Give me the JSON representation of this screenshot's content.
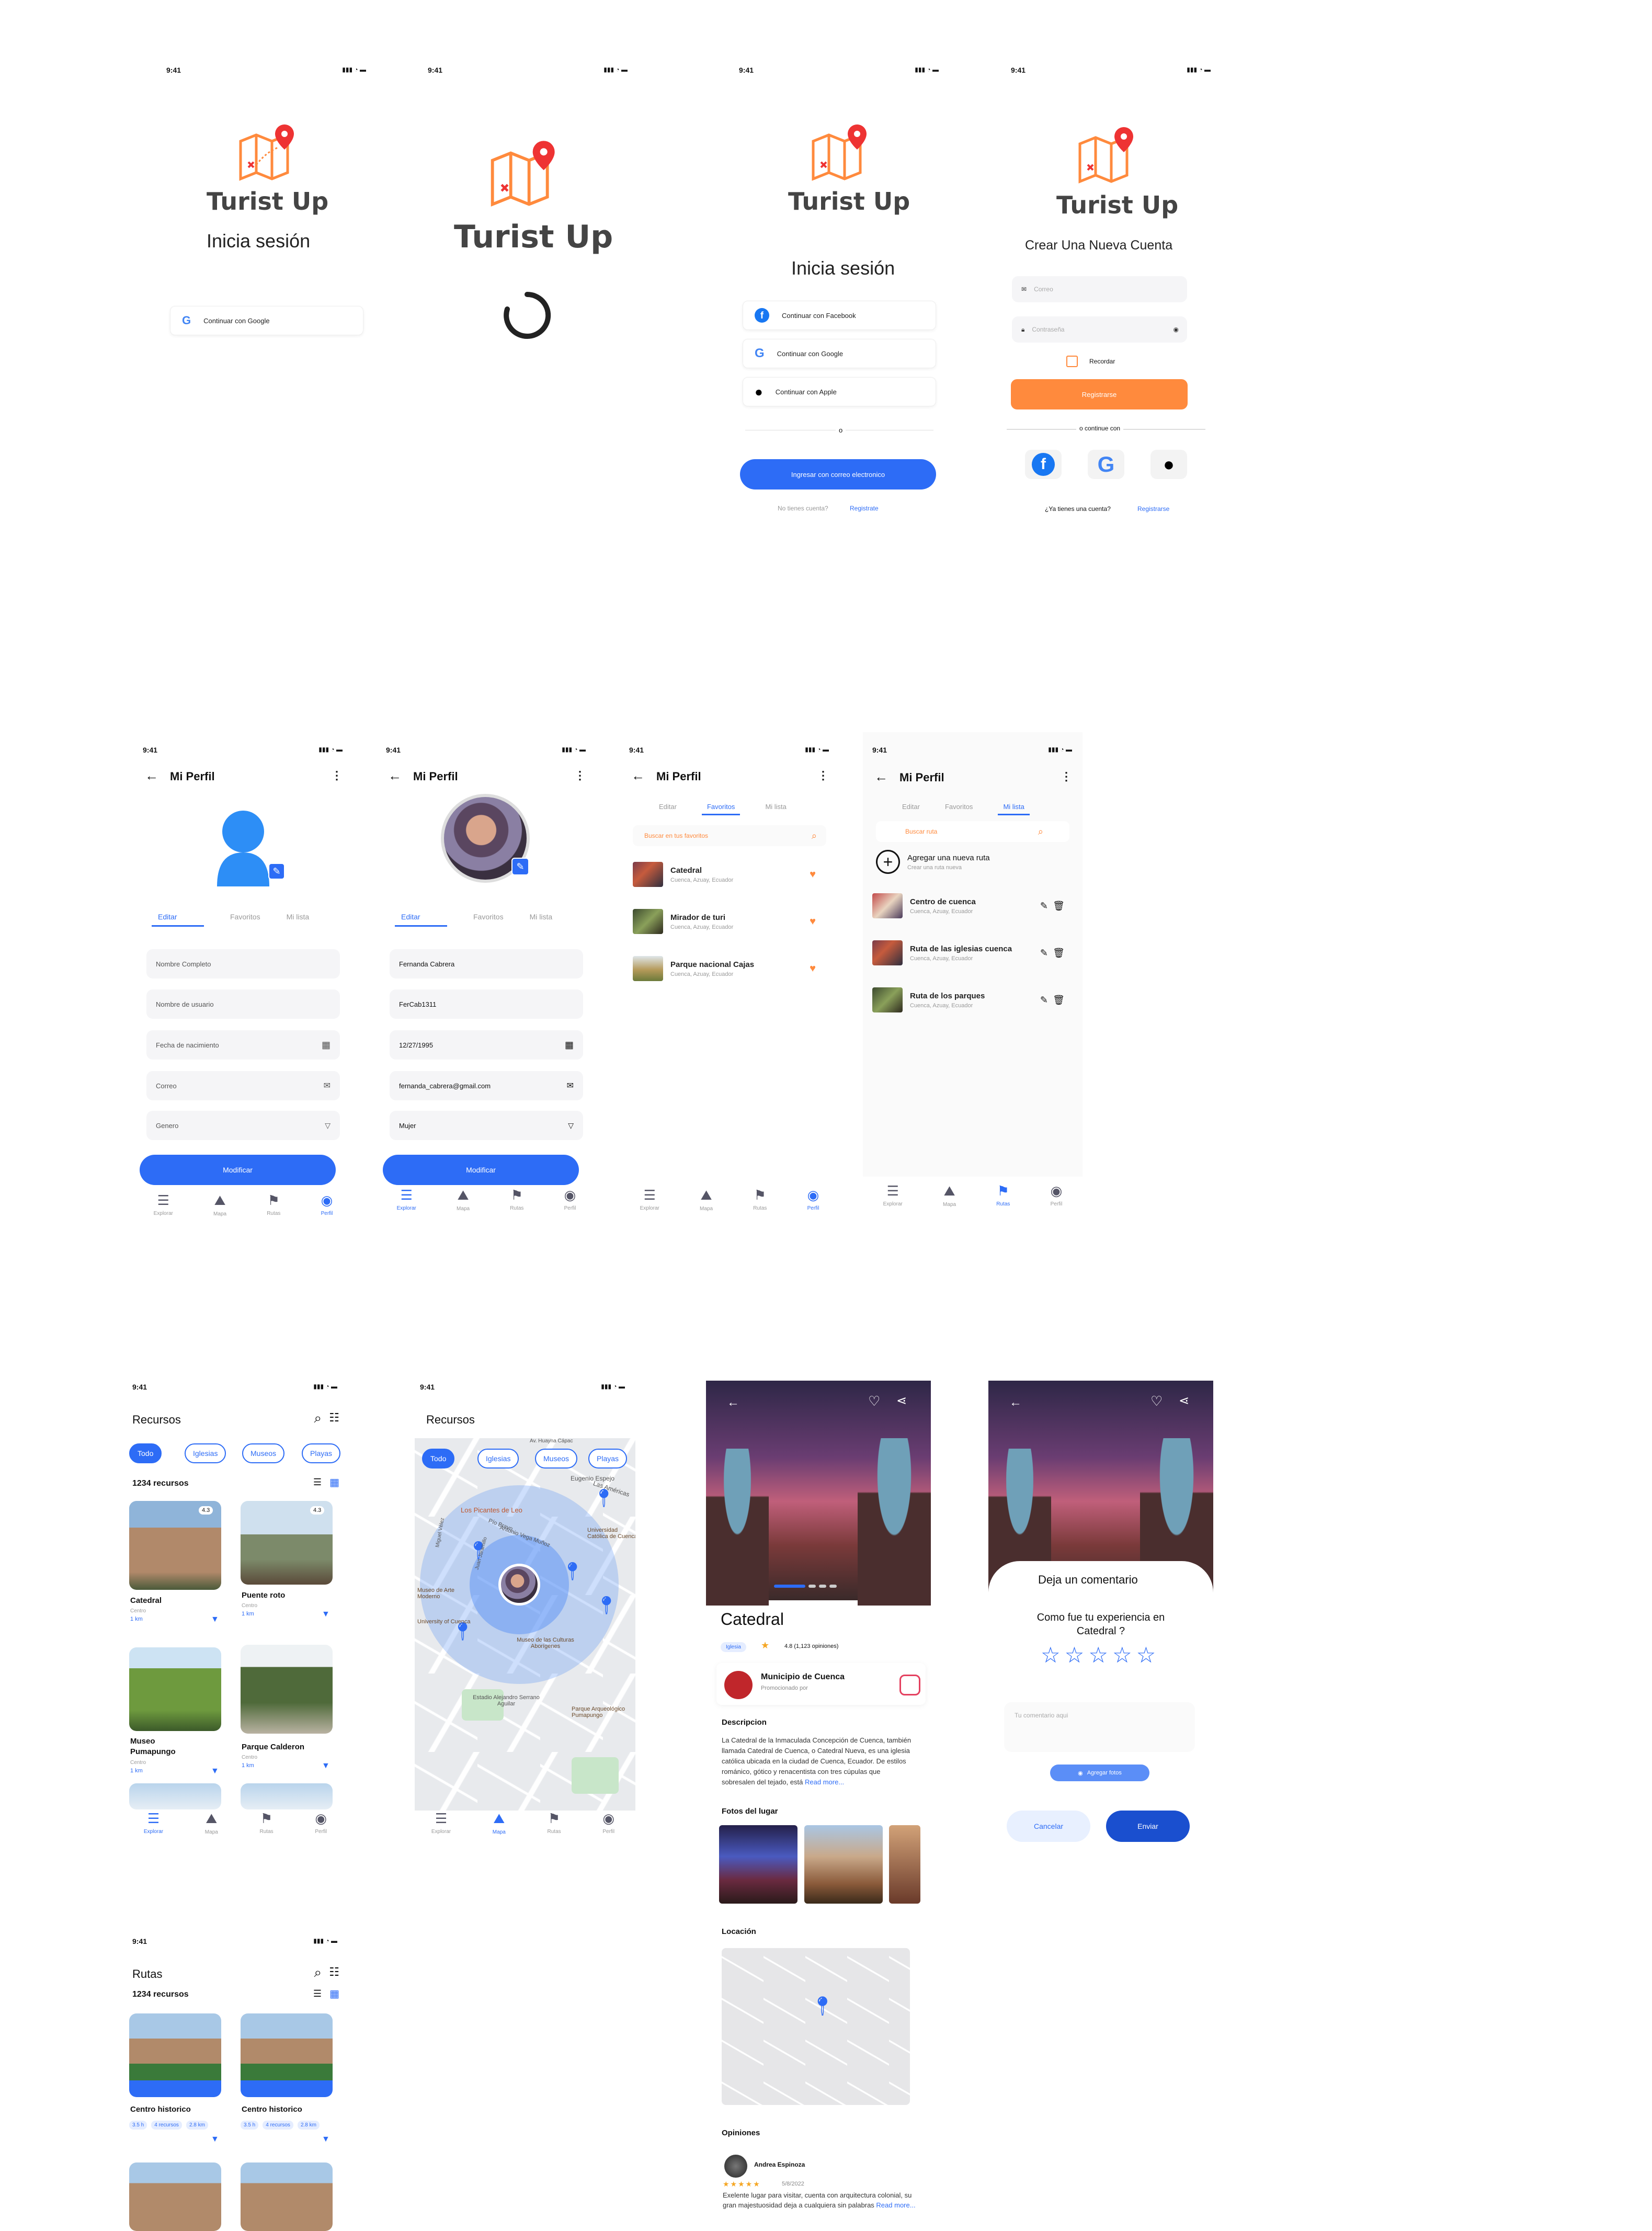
{
  "status_time": "9:41",
  "brand": "Turist Up",
  "accent": "#2d6cf6",
  "orange": "#ff8a3d",
  "login1": {
    "title": "Inicia sesión",
    "google": "Continuar con Google"
  },
  "login3": {
    "title": "Inicia sesión",
    "facebook": "Continuar con Facebook",
    "google": "Continuar con Google",
    "apple": "Continuar con Apple",
    "or": "o",
    "email_btn": "Ingresar con correo electronico",
    "no_account": "No tienes cuenta?",
    "register": "Registrate"
  },
  "register": {
    "title": "Crear Una Nueva Cuenta",
    "email_ph": "Correo",
    "pass_ph": "Contraseña",
    "remember": "Recordar",
    "btn": "Registrarse",
    "or": "o continue con",
    "have_account": "¿Ya tienes una cuenta?",
    "signin": "Registrarse"
  },
  "profile": {
    "title": "Mi Perfil",
    "tab_edit": "Editar",
    "tab_fav": "Favoritos",
    "tab_list": "Mi lista",
    "modify": "Modificar",
    "ph": {
      "name": "Nombre Completo",
      "user": "Nombre de usuario",
      "birth": "Fecha de nacimiento",
      "email": "Correo",
      "gender": "Genero"
    },
    "val": {
      "name": "Fernanda Cabrera",
      "user": "FerCab1311",
      "birth": "12/27/1995",
      "email": "fernanda_cabrera@gmail.com",
      "gender": "Mujer"
    },
    "search_fav": "Buscar en tus favoritos",
    "search_route": "Buscar ruta",
    "favorites": [
      {
        "t": "Catedral",
        "s": "Cuenca, Azuay, Ecuador"
      },
      {
        "t": "Mirador de turi",
        "s": "Cuenca, Azuay, Ecuador"
      },
      {
        "t": "Parque nacional Cajas",
        "s": "Cuenca, Azuay, Ecuador"
      }
    ],
    "add_route": "Agregar una nueva ruta",
    "add_route_sub": "Crear una ruta nueva",
    "routes": [
      {
        "t": "Centro de cuenca",
        "s": "Cuenca, Azuay, Ecuador"
      },
      {
        "t": "Ruta de las iglesias cuenca",
        "s": "Cuenca, Azuay, Ecuador"
      },
      {
        "t": "Ruta de los parques",
        "s": "Cuenca, Azuay, Ecuador"
      }
    ]
  },
  "nav": {
    "explore": "Explorar",
    "maps": "Mapa",
    "routes": "Rutas",
    "profile": "Perfil"
  },
  "resources": {
    "title": "Recursos",
    "count": "1234 recursos",
    "chips": [
      "Todo",
      "Iglesias",
      "Museos",
      "Playas"
    ],
    "cards": [
      {
        "t": "Catedral",
        "s": "Centro",
        "d": "1 km",
        "r": "4.3"
      },
      {
        "t": "Puente roto",
        "s": "Centro",
        "d": "1 km",
        "r": "4.3"
      },
      {
        "t": "Museo Pumapungo",
        "s": "Centro",
        "d": "1 km",
        "r": ""
      },
      {
        "t": "Parque Calderon",
        "s": "Centro",
        "d": "1 km",
        "r": ""
      }
    ]
  },
  "map": {
    "title": "Recursos",
    "chips": [
      "Todo",
      "Iglesias",
      "Museos",
      "Playas"
    ],
    "labels": [
      "Los Picantes de Leo",
      "Eugenio Espejo",
      "Las Américas",
      "Universidad Católica de Cuenca",
      "Museo de Arte Moderno",
      "University of Cuenca",
      "Museo de las Culturas Aborígenes",
      "Estadio Alejandro Serrano Aguilar",
      "Parque Arqueológico Pumapungo",
      "Pío Bravo",
      "Antonio Vega Muñoz",
      "Juan Jaramillo",
      "Miguel Vélez",
      "Av. Huayna Cápac"
    ]
  },
  "detail": {
    "title": "Catedral",
    "tag": "Iglesia",
    "rating": "4.8 (1,123 opiniones)",
    "org": "Municipio de Cuenca",
    "org_sub": "Promocionado por",
    "desc_title": "Descripcion",
    "desc": "La Catedral de la Inmaculada Concepción de Cuenca, también llamada Catedral de Cuenca, o Catedral Nueva, es una iglesia católica ubicada en la ciudad de Cuenca, Ecuador. De estilos románico, gótico y renacentista con tres cúpulas que sobresalen del tejado, está",
    "read_more": "Read more...",
    "photos_title": "Fotos del lugar",
    "loc_title": "Locación",
    "op_title": "Opiniones",
    "op_user": "Andrea Espinoza",
    "op_date": "5/8/2022",
    "op_text": "Exelente lugar para visitar, cuenta con arquitectura colonial, su gran majestuosidad deja a cualquiera sin palabras",
    "op_more": "Read more..."
  },
  "comment": {
    "title": "Deja un comentario",
    "question": "Como fue tu experiencia en Catedral ?",
    "ph": "Tu comentario aqui",
    "add_photos": "Agregar fotos",
    "cancel": "Cancelar",
    "send": "Enviar"
  },
  "routes_list": {
    "title": "Rutas",
    "count": "1234 recursos",
    "cards": [
      {
        "t": "Centro historico",
        "tags": [
          "3.5 h",
          "4 recursos",
          "2.8 km"
        ]
      },
      {
        "t": "Centro historico",
        "tags": [
          "3.5 h",
          "4 recursos",
          "2.8 km"
        ]
      }
    ]
  }
}
